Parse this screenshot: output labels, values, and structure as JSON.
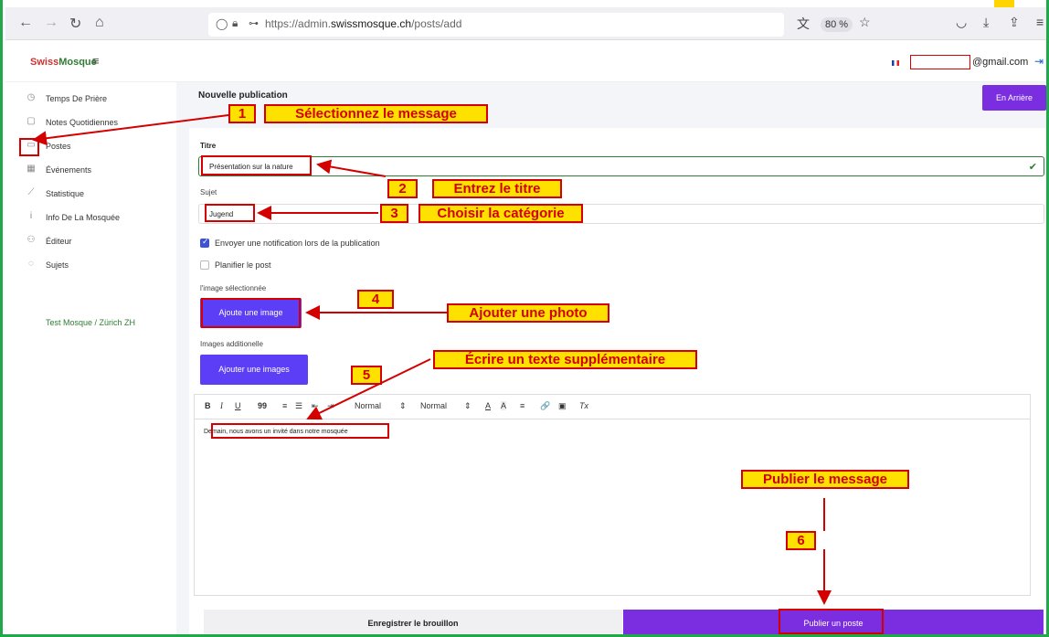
{
  "browser": {
    "url_prefix": "https://admin.",
    "url_domain": "swissmosque.ch",
    "url_path": "/posts/add",
    "zoom": "80 %"
  },
  "header": {
    "logo_red": "Swiss",
    "logo_green": "Mosque",
    "email_suffix": "@gmail.com"
  },
  "sidebar": {
    "items": [
      {
        "label": "Temps De Prière",
        "icon": "clock-icon"
      },
      {
        "label": "Notes Quotidiennes",
        "icon": "note-icon"
      },
      {
        "label": "Postes",
        "icon": "comment-icon"
      },
      {
        "label": "Événements",
        "icon": "calendar-icon"
      },
      {
        "label": "Statistique",
        "icon": "chart-icon"
      },
      {
        "label": "Info De La Mosquée",
        "icon": "info-icon"
      },
      {
        "label": "Éditeur",
        "icon": "users-icon"
      },
      {
        "label": "Sujets",
        "icon": "chat-icon"
      }
    ],
    "footer": "Test Mosque / Zürich ZH"
  },
  "main": {
    "page_title": "Nouvelle publication",
    "back_button": "En Arrière",
    "title_label": "Titre",
    "title_value": "Présentation sur la nature",
    "subject_label": "Sujet",
    "subject_value": "Jugend",
    "notify_label": "Envoyer une notification lors de la publication",
    "schedule_label": "Planifier le post",
    "selected_image_label": "l'image sélectionnée",
    "add_image_button": "Ajoute une image",
    "additional_images_label": "Images additionelle",
    "add_images_button": "Ajouter une images",
    "editor_toolbar": {
      "bold": "B",
      "italic": "I",
      "underline": "U",
      "quote": "99",
      "ordered": "≡",
      "bullet": "☰",
      "outdent": "⇤",
      "indent": "⇥",
      "size1": "Normal",
      "size2": "Normal",
      "color": "A",
      "bg": "A",
      "align": "≡",
      "link": "🔗",
      "image": "▣",
      "clear": "Tx"
    },
    "editor_text": "Demain, nous avons un invité dans notre mosquée",
    "draft_button": "Enregistrer le brouillon",
    "publish_button": "Publier un poste"
  },
  "annotations": {
    "n1": "1",
    "t1": "Sélectionnez le message",
    "n2": "2",
    "t2": "Entrez le titre",
    "n3": "3",
    "t3": "Choisir la catégorie",
    "n4": "4",
    "t4": "Ajouter une photo",
    "n5": "5",
    "t5": "Écrire un texte supplémentaire",
    "n6": "6",
    "t6": "Publier le message"
  }
}
